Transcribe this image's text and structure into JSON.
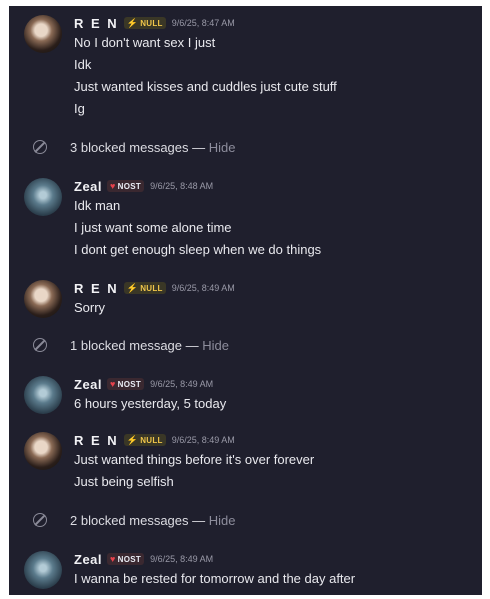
{
  "messages": [
    {
      "author": "R E N",
      "tag": "NULL",
      "tag_icon": "lightning-icon",
      "time": "9/6/25, 8:47 AM",
      "lines": [
        "No I don't want sex I just",
        "Idk",
        "Just wanted kisses and cuddles just cute stuff",
        "Ig"
      ]
    },
    {
      "blocked_text": "3 blocked messages — ",
      "hide_label": "Hide"
    },
    {
      "author": "Zeal",
      "tag": "NOST",
      "tag_icon": "heart-icon",
      "time": "9/6/25, 8:48 AM",
      "lines": [
        "Idk man",
        "I just want some alone time",
        "I dont get enough sleep when we do things"
      ]
    },
    {
      "author": "R E N",
      "tag": "NULL",
      "tag_icon": "lightning-icon",
      "time": "9/6/25, 8:49 AM",
      "lines": [
        "Sorry"
      ]
    },
    {
      "blocked_text": "1 blocked message — ",
      "hide_label": "Hide"
    },
    {
      "author": "Zeal",
      "tag": "NOST",
      "tag_icon": "heart-icon",
      "time": "9/6/25, 8:49 AM",
      "lines": [
        "6 hours yesterday, 5 today"
      ]
    },
    {
      "author": "R E N",
      "tag": "NULL",
      "tag_icon": "lightning-icon",
      "time": "9/6/25, 8:49 AM",
      "lines": [
        "Just wanted things before it's over forever",
        "Just being selfish"
      ]
    },
    {
      "blocked_text": "2 blocked messages — ",
      "hide_label": "Hide"
    },
    {
      "author": "Zeal",
      "tag": "NOST",
      "tag_icon": "heart-icon",
      "time": "9/6/25, 8:49 AM",
      "lines": [
        "I wanna be rested for tomorrow and the day after"
      ]
    }
  ],
  "colors": {
    "background": "#1f1f2d",
    "text": "#e9e9ee",
    "null_tag": "#f0c64a",
    "nost_icon": "#e6424c"
  }
}
